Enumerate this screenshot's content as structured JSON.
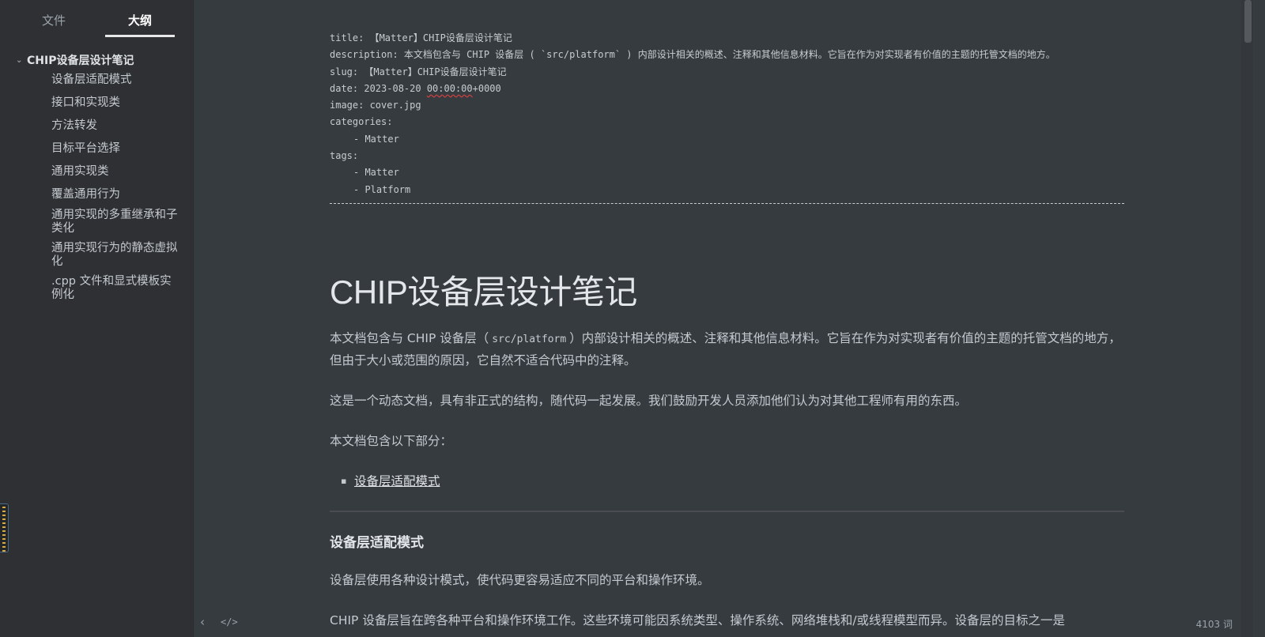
{
  "sidebar": {
    "tabs": [
      {
        "label": "文件"
      },
      {
        "label": "大纲"
      }
    ],
    "outline_root": "CHIP设备层设计笔记",
    "outline_items": [
      "设备层适配模式",
      "接口和实现类",
      "方法转发",
      "目标平台选择",
      "通用实现类",
      "覆盖通用行为",
      "通用实现的多重继承和子类化",
      "通用实现行为的静态虚拟化",
      ".cpp 文件和显式模板实例化"
    ]
  },
  "frontmatter": {
    "title_line": "title: 【Matter】CHIP设备层设计笔记",
    "description_line": "description: 本文档包含与 CHIP 设备层 ( `src/platform` ) 内部设计相关的概述、注释和其他信息材料。它旨在作为对实现者有价值的主题的托管文档的地方。",
    "slug_line": "slug: 【Matter】CHIP设备层设计笔记",
    "date_prefix": "date: 2023-08-20 ",
    "date_time": "00:00:00",
    "date_suffix": "+0000",
    "image_line": "image: cover.jpg",
    "categories_label": "categories:",
    "categories": [
      "- Matter"
    ],
    "tags_label": "tags:",
    "tags": [
      "- Matter",
      "- Platform"
    ]
  },
  "doc": {
    "heading": "CHIP设备层设计笔记",
    "p1_before": "本文档包含与 CHIP 设备层（",
    "p1_code": "src/platform",
    "p1_after": "）内部设计相关的概述、注释和其他信息材料。它旨在作为对实现者有价值的主题的托管文档的地方，但由于大小或范围的原因，它自然不适合代码中的注释。",
    "p2": "这是一个动态文档，具有非正式的结构，随代码一起发展。我们鼓励开发人员添加他们认为对其他工程师有用的东西。",
    "p3": "本文档包含以下部分：",
    "toc": [
      "设备层适配模式"
    ],
    "section_heading": "设备层适配模式",
    "p4": "设备层使用各种设计模式，使代码更容易适应不同的平台和操作环境。",
    "p5": "CHIP 设备层旨在跨各种平台和操作环境工作。这些环境可能因系统类型、操作系统、网络堆栈和/或线程模型而异。设备层的目标之一是"
  },
  "footer": {
    "back_glyph": "‹",
    "source_glyph": "</>",
    "word_count": "4103 词"
  },
  "colors": {
    "background": "#363b40",
    "sidebar": "#2e3033",
    "text": "#c4cacf",
    "heading": "#e4e7ea"
  }
}
